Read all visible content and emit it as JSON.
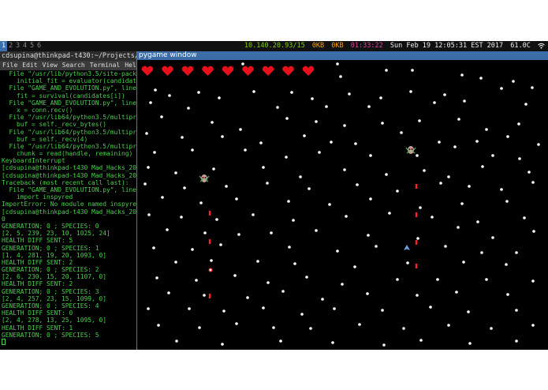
{
  "topbar": {
    "workspaces": [
      "1",
      "2",
      "3",
      "4",
      "5",
      "6"
    ],
    "active_workspace": "1",
    "ip": "10.140.20.93/15",
    "net_down": "0KB",
    "net_up": "0KB",
    "uptime": "01:33:22",
    "datetime": "Sun Feb 19 12:05:31 EST 2017",
    "temperature": "61.0C",
    "tray_icon": "wifi-icon"
  },
  "terminal": {
    "title": "cdsupina@thinkpad-t430:~/Projects/evolu",
    "menu": [
      "File",
      "Edit",
      "View",
      "Search",
      "Terminal",
      "Help"
    ],
    "lines": [
      "  File \"/usr/lib/python3.5/site-packa",
      "    initial_fit = evaluator(candidates",
      "  File \"GAME_AND_EVOLUTION.py\", line 6",
      "    fit = survival(candidates[i])",
      "  File \"GAME_AND_EVOLUTION.py\", line 4",
      "    x = conn.recv()",
      "  File \"/usr/lib64/python3.5/multiproc",
      "    buf = self._recv_bytes()",
      "  File \"/usr/lib64/python3.5/multiproc",
      "    buf = self._recv(4)",
      "  File \"/usr/lib64/python3.5/multiproc",
      "    chunk = read(handle, remaining)",
      "KeyboardInterrupt",
      "[cdsupina@thinkpad-t430 Mad_Hacks_201",
      "[cdsupina@thinkpad-t430 Mad_Hacks_201",
      "Traceback (most recent call last):",
      "  File \"GAME_AND_EVOLUTION.py\", line 1",
      "    import inspyred",
      "ImportError: No module named inspyred",
      "[cdsupina@thinkpad-t430 Mad_Hacks_201",
      "0",
      "GENERATION; 0 ; SPECIES: 0",
      "[2, 5, 239, 23, 10, 1025, 24]",
      "HEALTH DIFF SENT: 5",
      "GENERATION; 0 ; SPECIES: 1",
      "[1, 4, 281, 19, 20, 1093, 0]",
      "HEALTH DIFF SENT: 2",
      "GENERATION; 0 ; SPECIES: 2",
      "[2, 6, 230, 15, 20, 1107, 0]",
      "HEALTH DIFF SENT: 2",
      "GENERATION; 0 ; SPECIES: 3",
      "[2, 4, 257, 23, 15, 1099, 0]",
      "GENERATION; 0 ; SPECIES: 4",
      "HEALTH DIFF SENT: 0",
      "[2, 4, 278, 13, 25, 1095, 0]",
      "HEALTH DIFF SENT: 1",
      "GENERATION; 0 ; SPECIES: 5"
    ]
  },
  "pygame": {
    "title": "pygame window",
    "hearts": 9,
    "colors": {
      "heart": "#e8101a",
      "star": "#ffffff",
      "bullet": "#ff2020",
      "player": "#6aa0e0"
    }
  }
}
